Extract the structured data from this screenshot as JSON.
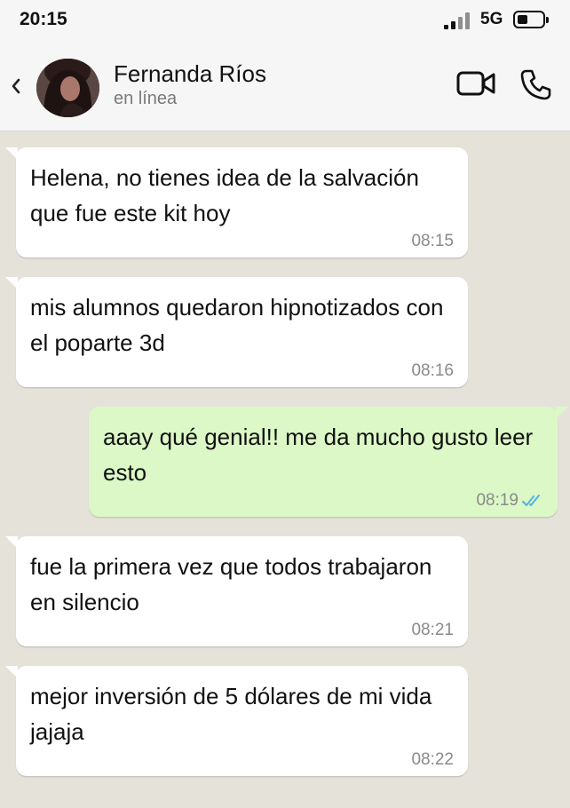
{
  "status_bar": {
    "time": "20:15",
    "network": "5G",
    "signal_icon": "signal-bars-icon",
    "battery_icon": "battery-icon",
    "battery_level": 0.3
  },
  "header": {
    "back_icon": "chevron-left-icon",
    "contact_name": "Fernanda Ríos",
    "contact_status": "en línea",
    "video_icon": "video-camera-icon",
    "call_icon": "phone-icon"
  },
  "colors": {
    "chat_background": "#e5e3d9",
    "incoming_bubble": "#ffffff",
    "outgoing_bubble": "#dcf8c6",
    "read_check": "#4fb3e8"
  },
  "messages": [
    {
      "direction": "incoming",
      "text": "Helena, no tienes idea de la salvación que fue este kit hoy",
      "time": "08:15"
    },
    {
      "direction": "incoming",
      "text": "mis alumnos quedaron hipnotizados con el poparte 3d",
      "time": "08:16"
    },
    {
      "direction": "outgoing",
      "text": "aaay qué genial!! me da mucho gusto leer esto",
      "time": "08:19",
      "status_icon": "double-check-read-icon"
    },
    {
      "direction": "incoming",
      "text": "fue la primera vez que todos trabajaron en silencio",
      "time": "08:21"
    },
    {
      "direction": "incoming",
      "text": "mejor inversión de 5 dólares de mi vida jajaja",
      "time": "08:22"
    }
  ]
}
